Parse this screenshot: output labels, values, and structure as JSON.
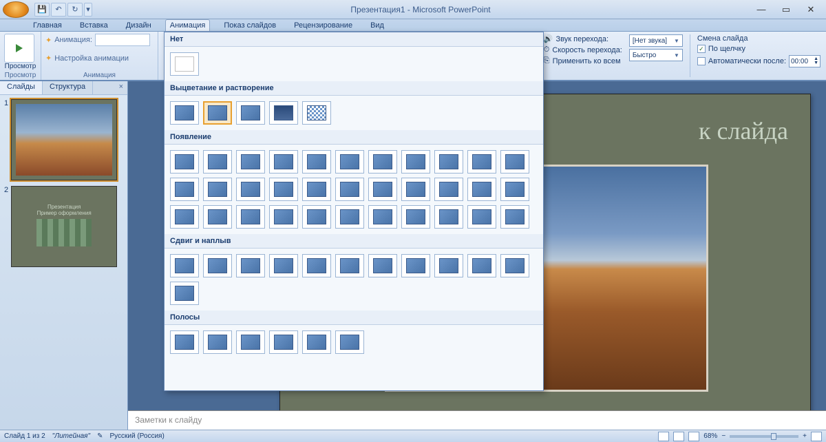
{
  "title": "Презентация1 - Microsoft PowerPoint",
  "qat": {
    "save": "save",
    "undo": "undo",
    "redo": "redo"
  },
  "tabs": [
    "Главная",
    "Вставка",
    "Дизайн",
    "Анимация",
    "Показ слайдов",
    "Рецензирование",
    "Вид"
  ],
  "active_tab": "Анимация",
  "ribbon": {
    "preview_label": "Просмотр",
    "preview_btn": "Просмотр",
    "anim_label": "Анимация:",
    "anim_custom": "Настройка анимации",
    "anim_group": "Анимация",
    "sound_label": "Звук перехода:",
    "sound_value": "[Нет звука]",
    "speed_label": "Скорость перехода:",
    "speed_value": "Быстро",
    "apply_all": "Применить ко всем",
    "change_label": "Смена слайда",
    "on_click": "По щелчку",
    "auto_after": "Автоматически после:",
    "auto_time": "00:00"
  },
  "gallery": {
    "s1": "Нет",
    "s2": "Выцветание и растворение",
    "s3": "Появление",
    "s4": "Сдвиг и наплыв",
    "s5": "Полосы"
  },
  "left": {
    "tab_slides": "Слайды",
    "tab_outline": "Структура",
    "n1": "1",
    "n2": "2",
    "t2_title": "Презентация",
    "t2_sub": "Пример оформления"
  },
  "slide": {
    "title_placeholder": "к слайда"
  },
  "notes": "Заметки к слайду",
  "status": {
    "slide": "Слайд 1 из 2",
    "theme": "\"Литейная\"",
    "lang": "Русский (Россия)",
    "zoom": "68%"
  }
}
